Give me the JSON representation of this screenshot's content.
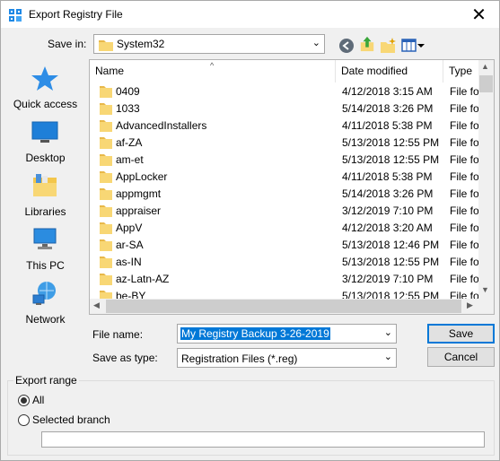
{
  "window": {
    "title": "Export Registry File",
    "close_glyph": "✕"
  },
  "save_in": {
    "label": "Save in:",
    "value": "System32"
  },
  "toolbar": {
    "icons": [
      "back-icon",
      "up-folder-icon",
      "new-folder-icon",
      "view-menu-icon"
    ]
  },
  "places": [
    {
      "label": "Quick access",
      "icon": "quick-access-star-icon"
    },
    {
      "label": "Desktop",
      "icon": "desktop-icon"
    },
    {
      "label": "Libraries",
      "icon": "libraries-icon"
    },
    {
      "label": "This PC",
      "icon": "this-pc-icon"
    },
    {
      "label": "Network",
      "icon": "network-icon"
    }
  ],
  "columns": {
    "name": "Name",
    "date": "Date modified",
    "type": "Type"
  },
  "files": [
    {
      "name": "0409",
      "date": "4/12/2018 3:15 AM",
      "type": "File fol"
    },
    {
      "name": "1033",
      "date": "5/14/2018 3:26 PM",
      "type": "File fol"
    },
    {
      "name": "AdvancedInstallers",
      "date": "4/11/2018 5:38 PM",
      "type": "File fol"
    },
    {
      "name": "af-ZA",
      "date": "5/13/2018 12:55 PM",
      "type": "File fol"
    },
    {
      "name": "am-et",
      "date": "5/13/2018 12:55 PM",
      "type": "File fol"
    },
    {
      "name": "AppLocker",
      "date": "4/11/2018 5:38 PM",
      "type": "File fol"
    },
    {
      "name": "appmgmt",
      "date": "5/14/2018 3:26 PM",
      "type": "File fol"
    },
    {
      "name": "appraiser",
      "date": "3/12/2019 7:10 PM",
      "type": "File fol"
    },
    {
      "name": "AppV",
      "date": "4/12/2018 3:20 AM",
      "type": "File fol"
    },
    {
      "name": "ar-SA",
      "date": "5/13/2018 12:46 PM",
      "type": "File fol"
    },
    {
      "name": "as-IN",
      "date": "5/13/2018 12:55 PM",
      "type": "File fol"
    },
    {
      "name": "az-Latn-AZ",
      "date": "3/12/2019 7:10 PM",
      "type": "File fol"
    },
    {
      "name": "be-BY",
      "date": "5/13/2018 12:55 PM",
      "type": "File fol"
    }
  ],
  "file_name": {
    "label": "File name:",
    "value": "My Registry Backup 3-26-2019"
  },
  "save_as_type": {
    "label": "Save as type:",
    "value": "Registration Files (*.reg)"
  },
  "buttons": {
    "save": "Save",
    "cancel": "Cancel"
  },
  "export_range": {
    "title": "Export range",
    "all_label": "All",
    "branch_label": "Selected branch",
    "selected": "All",
    "branch_value": ""
  }
}
